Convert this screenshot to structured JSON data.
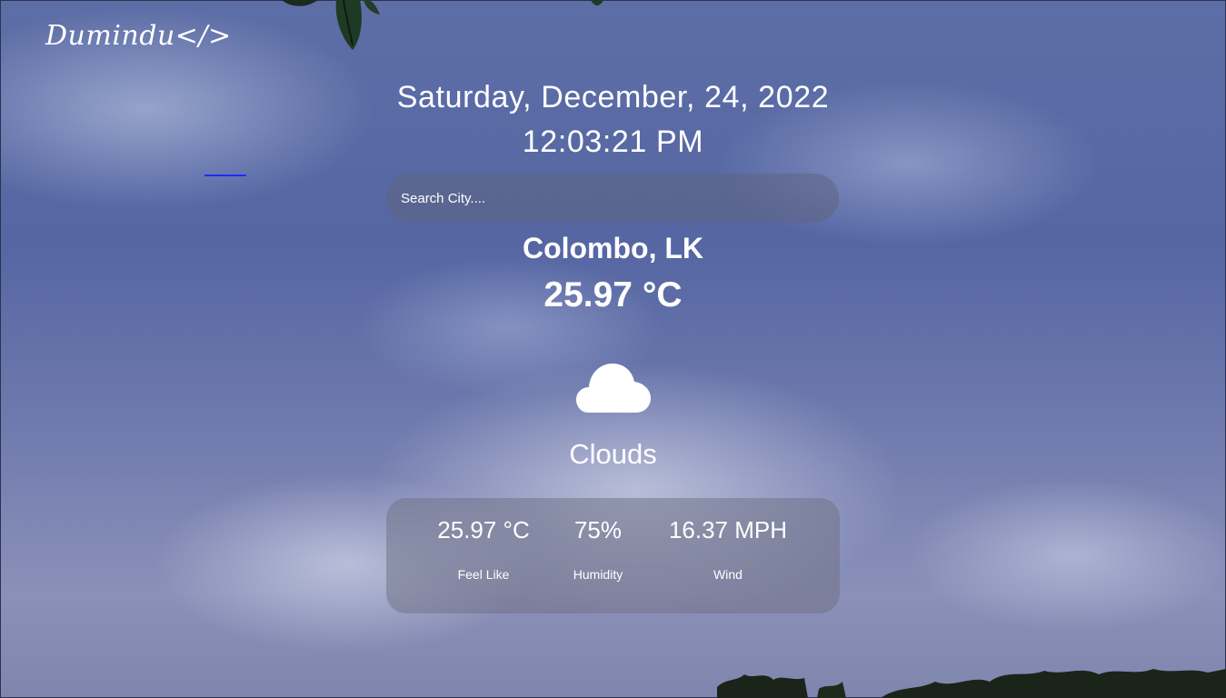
{
  "brand": {
    "logo_text": "Dumindu</>"
  },
  "datetime": {
    "date": "Saturday, December, 24, 2022",
    "time": "12:03:21 PM"
  },
  "search": {
    "placeholder": "Search City...."
  },
  "weather": {
    "city": "Colombo, LK",
    "temperature": "25.97 °C",
    "icon": "cloud-icon",
    "condition": "Clouds"
  },
  "details": {
    "feels_like": {
      "value": "25.97 °C",
      "label": "Feel Like"
    },
    "humidity": {
      "value": "75%",
      "label": "Humidity"
    },
    "wind": {
      "value": "16.37 MPH",
      "label": "Wind"
    }
  },
  "colors": {
    "text": "#ffffff",
    "accent_underline": "#1a2dff",
    "panel": "rgba(110,112,130,0.50)"
  }
}
